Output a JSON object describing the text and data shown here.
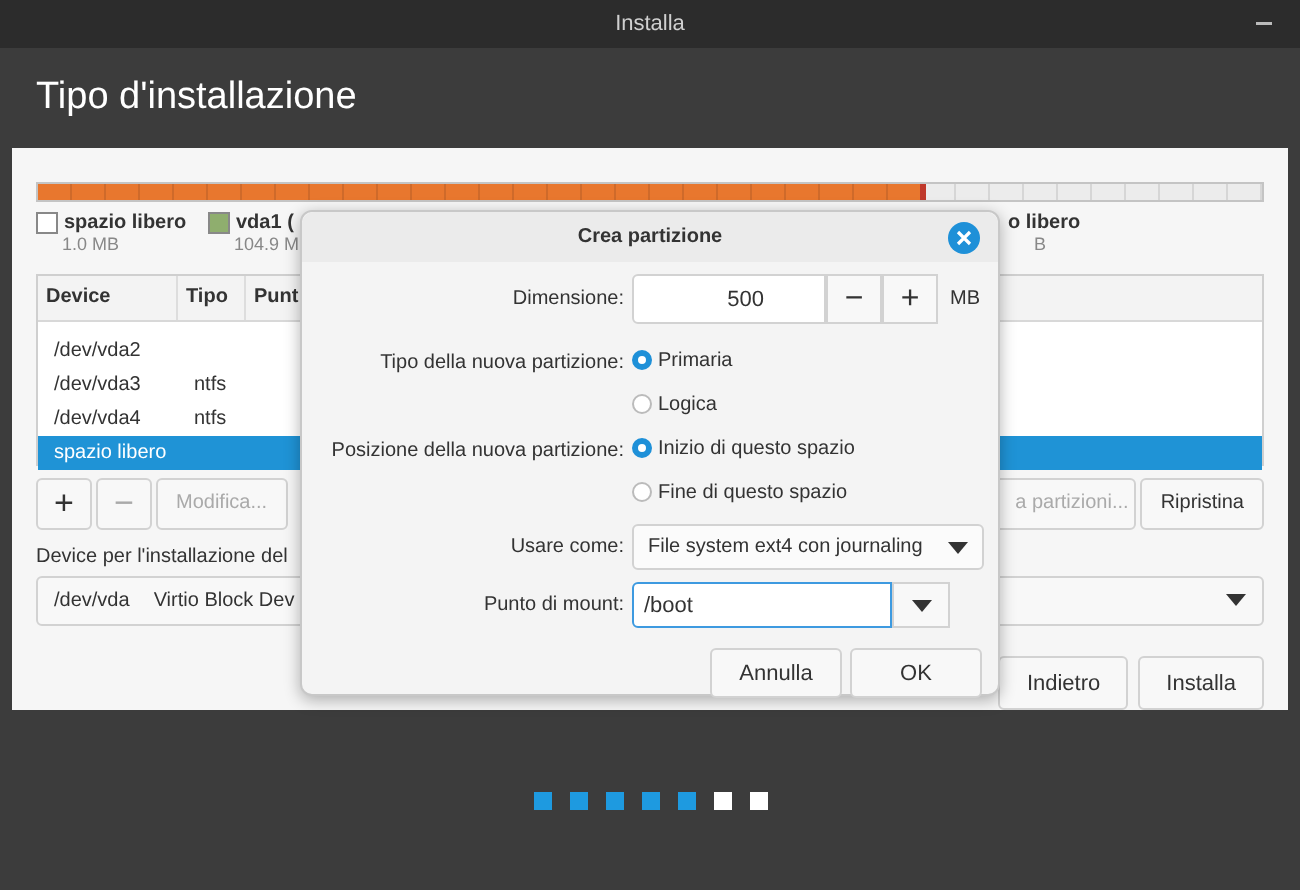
{
  "window": {
    "title": "Installa"
  },
  "header": {
    "title": "Tipo d'installazione"
  },
  "usage_bar": {
    "level": 0.725
  },
  "legend": [
    {
      "name": "spazio libero",
      "size": "1.0 MB",
      "color": "#ffffff"
    },
    {
      "name": "vda1 (",
      "size": "104.9 M",
      "color": "#8fae6e"
    },
    {
      "name": "o libero",
      "size": "B"
    }
  ],
  "table": {
    "columns": [
      "Device",
      "Tipo",
      "Punt"
    ],
    "rows": [
      {
        "device": "/dev/vda2",
        "type": "",
        "selected": false
      },
      {
        "device": "/dev/vda3",
        "type": "ntfs",
        "selected": false
      },
      {
        "device": "/dev/vda4",
        "type": "ntfs",
        "selected": false
      },
      {
        "device": "spazio libero",
        "type": "",
        "selected": true
      }
    ]
  },
  "toolbar": [
    {
      "kind": "icon",
      "label": "+",
      "disabled": false
    },
    {
      "kind": "icon",
      "label": "−",
      "disabled": true
    },
    {
      "kind": "text",
      "label": "Modifica...",
      "disabled": true
    },
    {
      "kind": "gap"
    },
    {
      "kind": "text",
      "label": "a partizioni...",
      "disabled": true
    },
    {
      "kind": "text",
      "label": "Ripristina",
      "disabled": false
    }
  ],
  "boot_device": {
    "label": "Device per l'installazione del",
    "device": "/dev/vda",
    "description": "Virtio Block Dev"
  },
  "buttons": [
    "Indietro",
    "Installa"
  ],
  "steps": [
    {
      "done": true
    },
    {
      "done": true
    },
    {
      "done": true
    },
    {
      "done": true
    },
    {
      "done": true
    },
    {
      "done": false
    },
    {
      "done": false
    }
  ],
  "dialog": {
    "title": "Crea partizione",
    "fields": [
      {
        "kind": "spin",
        "label": "Dimensione:",
        "value": "500",
        "minus": "−",
        "plus": "+",
        "unit": "MB"
      },
      {
        "kind": "radio",
        "label": "Tipo della nuova partizione:",
        "options": [
          {
            "label": "Primaria",
            "selected": true
          },
          {
            "label": "Logica",
            "selected": false
          }
        ]
      },
      {
        "kind": "radio",
        "label": "Posizione della nuova partizione:",
        "options": [
          {
            "label": "Inizio di questo spazio",
            "selected": true
          },
          {
            "label": "Fine di questo spazio",
            "selected": false
          }
        ]
      },
      {
        "kind": "combo",
        "label": "Usare come:",
        "value": "File system ext4 con journaling"
      },
      {
        "kind": "entry",
        "label": "Punto di mount:",
        "value": "/boot",
        "focused": true
      }
    ],
    "buttons": [
      "Annulla",
      "OK"
    ]
  }
}
